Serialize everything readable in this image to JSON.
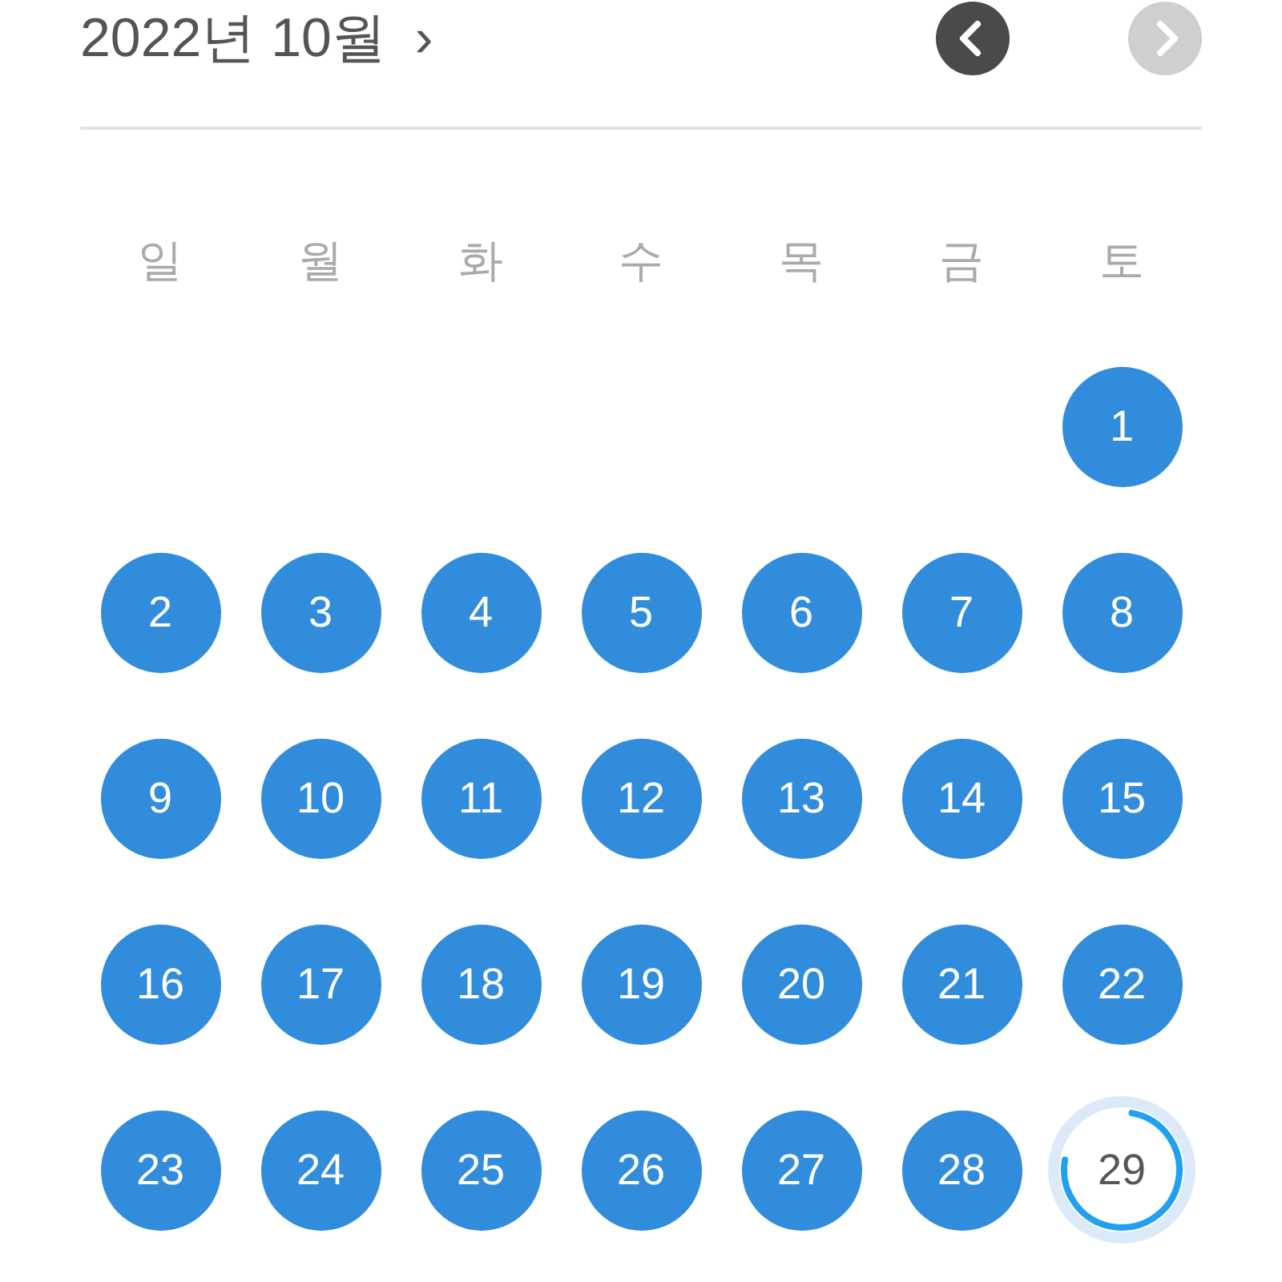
{
  "header": {
    "title": "2022년 10월",
    "title_arrow": "›",
    "prev_enabled": true,
    "next_enabled": false
  },
  "weekdays": [
    "일",
    "월",
    "화",
    "수",
    "목",
    "금",
    "토"
  ],
  "weeks": [
    [
      {
        "kind": "blank"
      },
      {
        "kind": "blank"
      },
      {
        "kind": "blank"
      },
      {
        "kind": "blank"
      },
      {
        "kind": "blank"
      },
      {
        "kind": "blank"
      },
      {
        "day": "1",
        "kind": "done"
      }
    ],
    [
      {
        "day": "2",
        "kind": "done"
      },
      {
        "day": "3",
        "kind": "done"
      },
      {
        "day": "4",
        "kind": "done"
      },
      {
        "day": "5",
        "kind": "done"
      },
      {
        "day": "6",
        "kind": "done"
      },
      {
        "day": "7",
        "kind": "done"
      },
      {
        "day": "8",
        "kind": "done"
      }
    ],
    [
      {
        "day": "9",
        "kind": "done"
      },
      {
        "day": "10",
        "kind": "done"
      },
      {
        "day": "11",
        "kind": "done"
      },
      {
        "day": "12",
        "kind": "done"
      },
      {
        "day": "13",
        "kind": "done"
      },
      {
        "day": "14",
        "kind": "done"
      },
      {
        "day": "15",
        "kind": "done"
      }
    ],
    [
      {
        "day": "16",
        "kind": "done"
      },
      {
        "day": "17",
        "kind": "done"
      },
      {
        "day": "18",
        "kind": "done"
      },
      {
        "day": "19",
        "kind": "done"
      },
      {
        "day": "20",
        "kind": "done"
      },
      {
        "day": "21",
        "kind": "done"
      },
      {
        "day": "22",
        "kind": "done"
      }
    ],
    [
      {
        "day": "23",
        "kind": "done"
      },
      {
        "day": "24",
        "kind": "done"
      },
      {
        "day": "25",
        "kind": "done"
      },
      {
        "day": "26",
        "kind": "done"
      },
      {
        "day": "27",
        "kind": "done"
      },
      {
        "day": "28",
        "kind": "done"
      },
      {
        "day": "29",
        "kind": "today",
        "level": 0.75
      }
    ]
  ]
}
